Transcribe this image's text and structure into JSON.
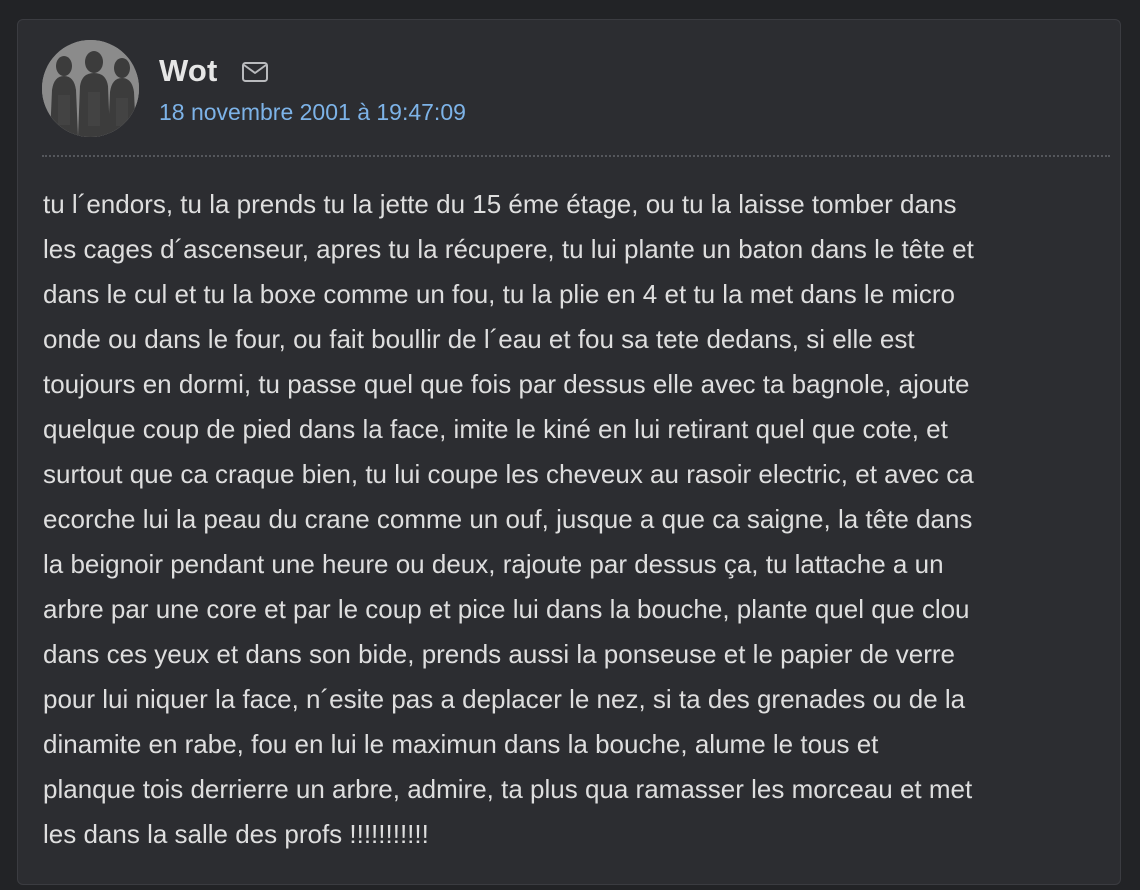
{
  "post": {
    "author": "Wot",
    "date": "18 novembre 2001 à 19:47:09",
    "icons": {
      "avatar": "avatar-image",
      "mail": "mail-icon"
    },
    "body": "tu l´endors, tu la prends tu la jette du 15 éme étage, ou tu la laisse tomber dans\nles cages d´ascenseur, apres tu la récupere, tu lui plante un baton dans le tête et\ndans le cul et tu la boxe comme un fou, tu la plie en 4 et tu la met dans le micro\nonde ou dans le four, ou fait boullir de l´eau et fou sa tete dedans, si elle est\ntoujours en dormi, tu passe quel que fois par dessus elle avec ta bagnole, ajoute\nquelque coup de pied dans la face, imite le kiné en lui retirant quel que cote, et\nsurtout que ca craque bien, tu lui coupe les cheveux au rasoir electric, et avec ca\necorche lui la peau du crane comme un ouf, jusque a que ca saigne, la tête dans\nla beignoir pendant une heure ou deux, rajoute par dessus ça, tu lattache a un\narbre par une core et par le coup et pice lui dans la bouche, plante quel que clou\ndans ces yeux et dans son bide, prends aussi la ponseuse et le papier de verre\npour lui niquer la face, n´esite pas a deplacer le nez, si ta des grenades ou de la\ndinamite en rabe, fou en lui le maximun dans la bouche, alume le tous et\nplanque tois derrierre un arbre, admire, ta plus qua ramasser les morceau et met\nles dans la salle des profs !!!!!!!!!!!"
  },
  "colors": {
    "page_bg": "#222326",
    "card_bg": "#2c2d31",
    "text": "#dedede",
    "author": "#e6e6e6",
    "date_link": "#7db3e8"
  }
}
